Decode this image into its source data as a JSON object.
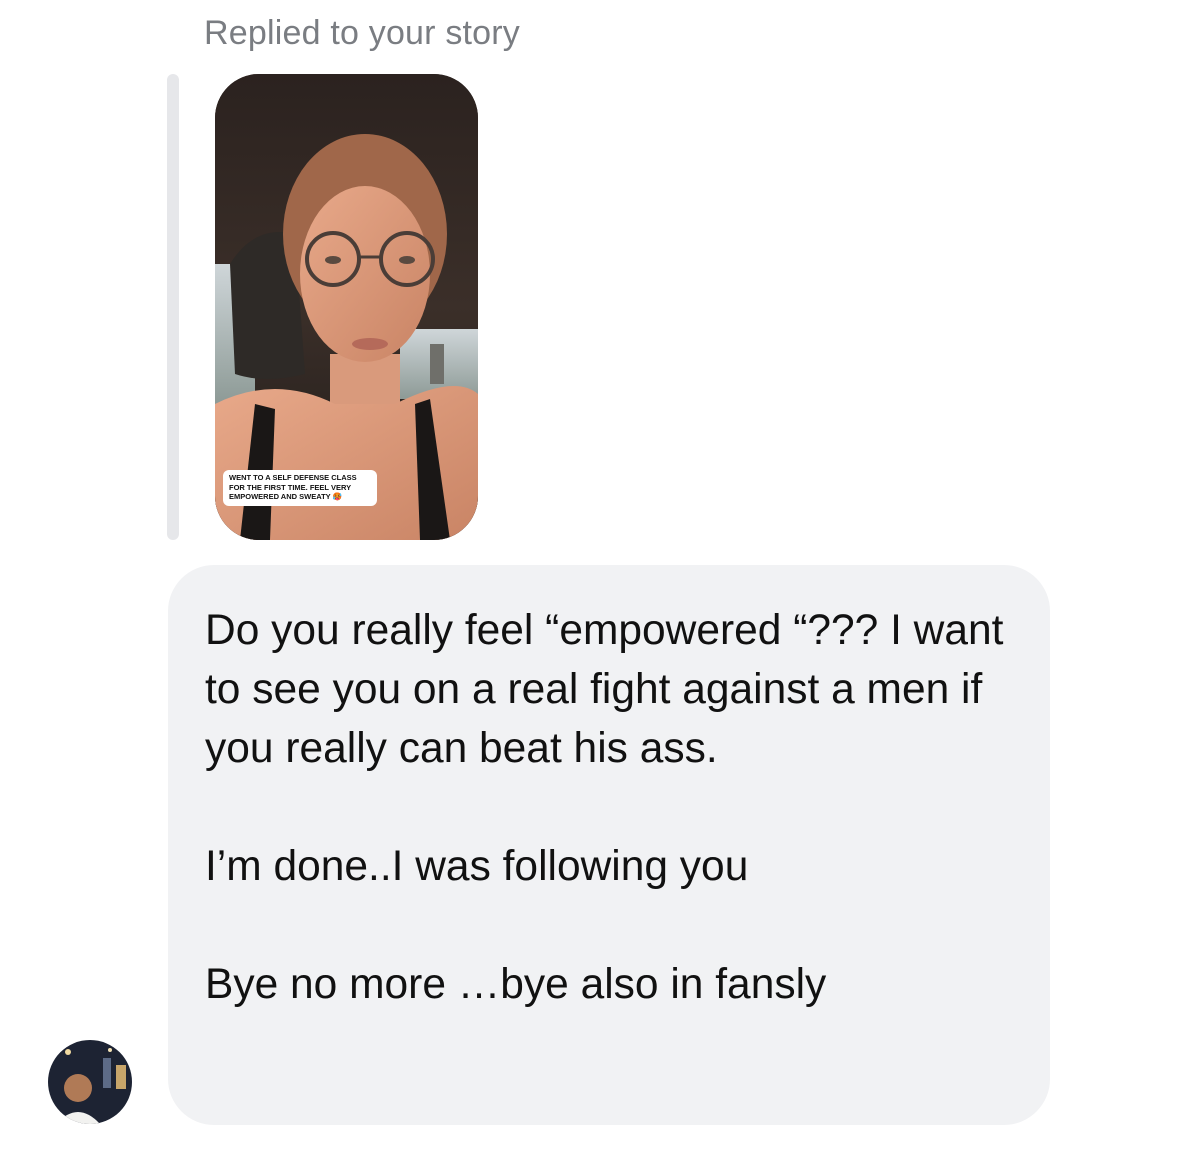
{
  "header": {
    "reply_context": "Replied to your story"
  },
  "story": {
    "caption": "WENT TO A SELF DEFENSE CLASS FOR THE FIRST TIME. FEEL VERY EMPOWERED AND SWEATY",
    "caption_emoji": "🥵"
  },
  "message": {
    "paragraphs": [
      "Do you really feel “empowered “??? I want to see you on a real fight against a men if you really can beat his ass.",
      "I’m done..I was following you",
      "Bye no more …bye also in fansly"
    ]
  },
  "colors": {
    "bubble_background": "#f1f2f4",
    "header_text": "#7a7d82",
    "reply_bar": "#e6e7ea"
  }
}
